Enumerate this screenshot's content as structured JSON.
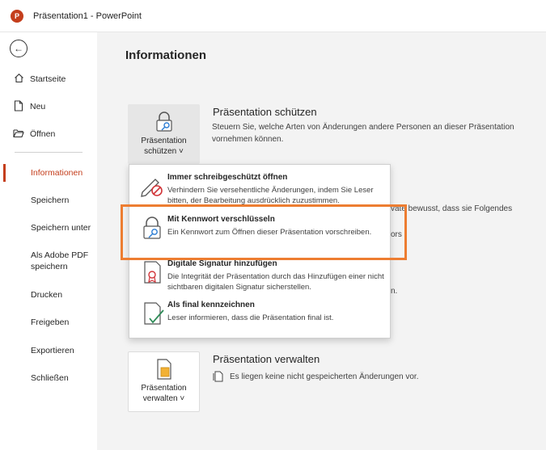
{
  "titlebar": {
    "app_logo": "P",
    "title": "Präsentation1  -  PowerPoint"
  },
  "nav": {
    "back_icon": "back-arrow-icon",
    "items": [
      {
        "label": "Startseite",
        "icon": "home-icon"
      },
      {
        "label": "Neu",
        "icon": "new-document-icon"
      },
      {
        "label": "Öffnen",
        "icon": "folder-open-icon"
      },
      {
        "label": "Informationen"
      },
      {
        "label": "Speichern"
      },
      {
        "label": "Speichern unter"
      },
      {
        "label": "Als Adobe PDF\nspeichern"
      },
      {
        "label": "Drucken"
      },
      {
        "label": "Freigeben"
      },
      {
        "label": "Exportieren"
      },
      {
        "label": "Schließen"
      }
    ],
    "active": "Informationen",
    "accent_color": "#c43e1c"
  },
  "main": {
    "page_title": "Informationen",
    "protect": {
      "tile_label": "Präsentation\nschützen ˅",
      "heading": "Präsentation schützen",
      "description": "Steuern Sie, welche Arten von Änderungen andere Personen an dieser Präsentation vornehmen können."
    },
    "partial_text": {
      "line1": "vate bewusst, dass sie Folgendes",
      "line2": "ors",
      "line3": "n."
    },
    "dropdown": [
      {
        "title": "Immer schreibgeschützt öffnen",
        "description": "Verhindern Sie versehentliche Änderungen, indem Sie Leser bitten, der Bearbeitung ausdrücklich zuzustimmen.",
        "icon": "pencil-no-edit-icon"
      },
      {
        "title": "Mit Kennwort verschlüsseln",
        "description": "Ein Kennwort zum Öffnen dieser Präsentation vorschreiben.",
        "icon": "lock-key-icon"
      },
      {
        "title": "Digitale Signatur hinzufügen",
        "description": "Die Integrität der Präsentation durch das Hinzufügen einer nicht sichtbaren digitalen Signatur sicherstellen.",
        "icon": "signature-ribbon-icon"
      },
      {
        "title": "Als final kennzeichnen",
        "description": "Leser informieren, dass die Präsentation final ist.",
        "icon": "final-check-icon"
      }
    ],
    "manage": {
      "tile_label": "Präsentation\nverwalten ˅",
      "heading": "Präsentation verwalten",
      "status": "Es liegen keine nicht gespeicherten Änderungen vor."
    },
    "highlight_color": "#ed7d31"
  }
}
